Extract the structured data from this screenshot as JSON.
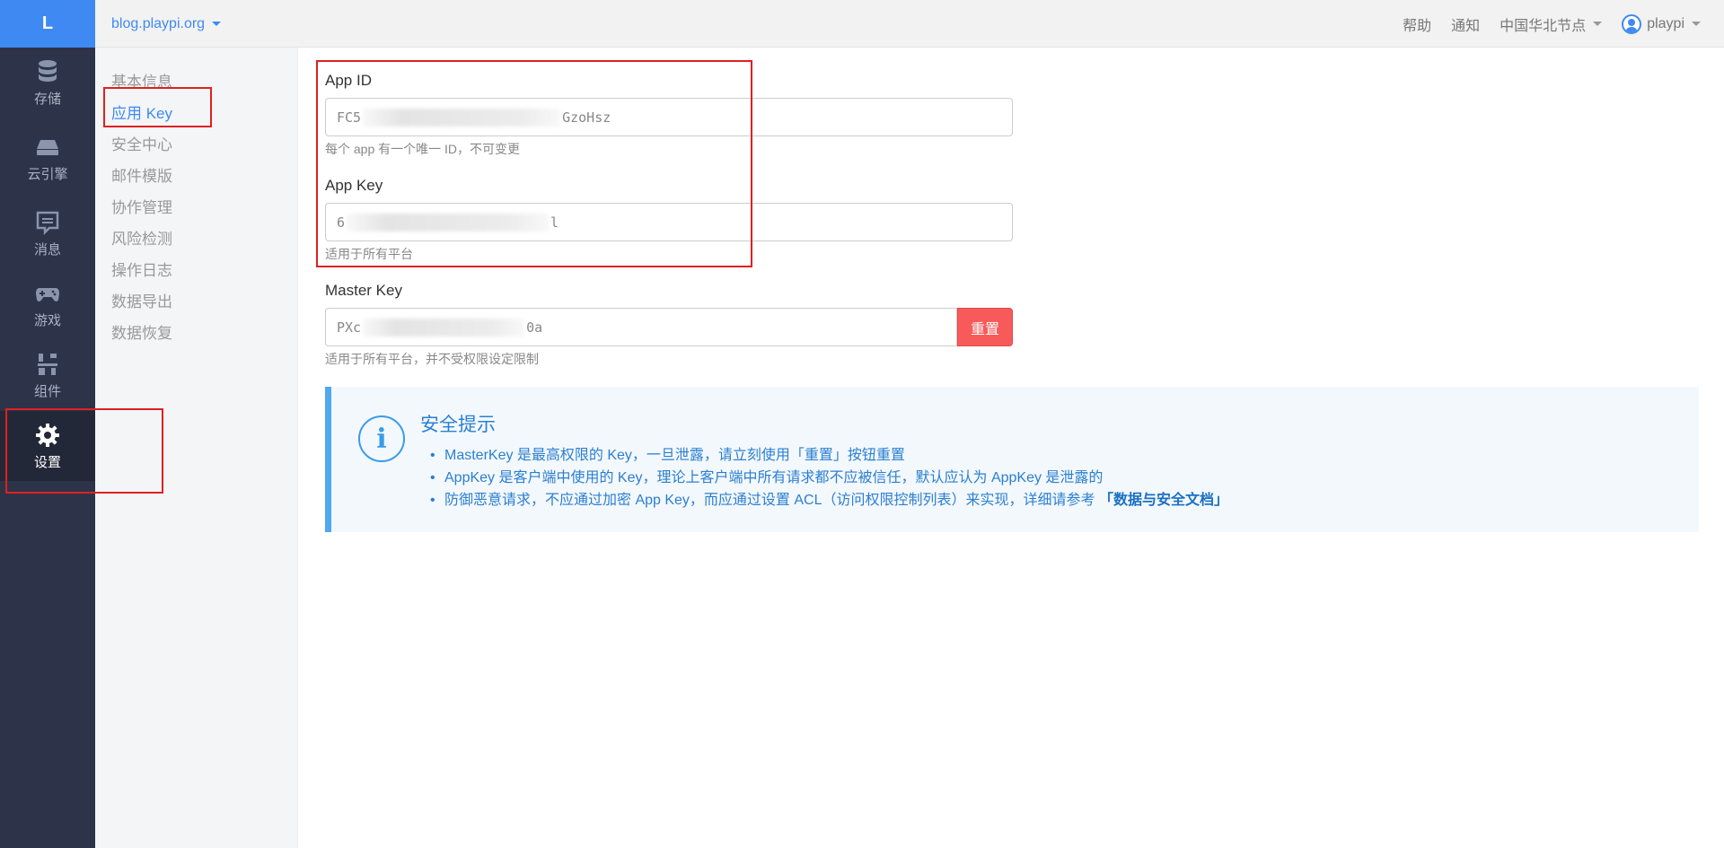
{
  "topbar": {
    "logo": "L",
    "app_name": "blog.playpi.org",
    "help": "帮助",
    "notify": "通知",
    "region": "中国华北节点",
    "user": "playpi"
  },
  "leftnav": [
    {
      "label": "存储",
      "icon": "database-icon"
    },
    {
      "label": "云引擎",
      "icon": "cloud-engine-icon"
    },
    {
      "label": "消息",
      "icon": "message-icon"
    },
    {
      "label": "游戏",
      "icon": "gamepad-icon"
    },
    {
      "label": "组件",
      "icon": "components-icon"
    },
    {
      "label": "设置",
      "icon": "gear-icon",
      "active": true
    }
  ],
  "subnav": [
    "基本信息",
    "应用 Key",
    "安全中心",
    "邮件模版",
    "协作管理",
    "风险检测",
    "操作日志",
    "数据导出",
    "数据恢复"
  ],
  "subnav_active": "应用 Key",
  "fields": {
    "app_id": {
      "label": "App ID",
      "value_start": "FC5",
      "value_end": "GzoHsz",
      "help": "每个 app 有一个唯一 ID，不可变更"
    },
    "app_key": {
      "label": "App Key",
      "value_start": "6",
      "value_end": "l",
      "help": "适用于所有平台"
    },
    "master_key": {
      "label": "Master Key",
      "value_start": "PXc",
      "value_end": "0a",
      "help": "适用于所有平台，并不受权限设定限制",
      "reset": "重置"
    }
  },
  "tip": {
    "title": "安全提示",
    "items": [
      "MasterKey 是最高权限的 Key，一旦泄露，请立刻使用「重置」按钮重置",
      "AppKey 是客户端中使用的 Key，理论上客户端中所有请求都不应被信任，默认应认为 AppKey 是泄露的",
      "防御恶意请求，不应通过加密 App Key，而应通过设置 ACL（访问权限控制列表）来实现，详细请参考 "
    ],
    "link": "「数据与安全文档」"
  },
  "colors": {
    "accent": "#3f8af2",
    "danger": "#f85a5a",
    "nav_bg": "#2d3349",
    "highlight_box": "#e02020"
  }
}
